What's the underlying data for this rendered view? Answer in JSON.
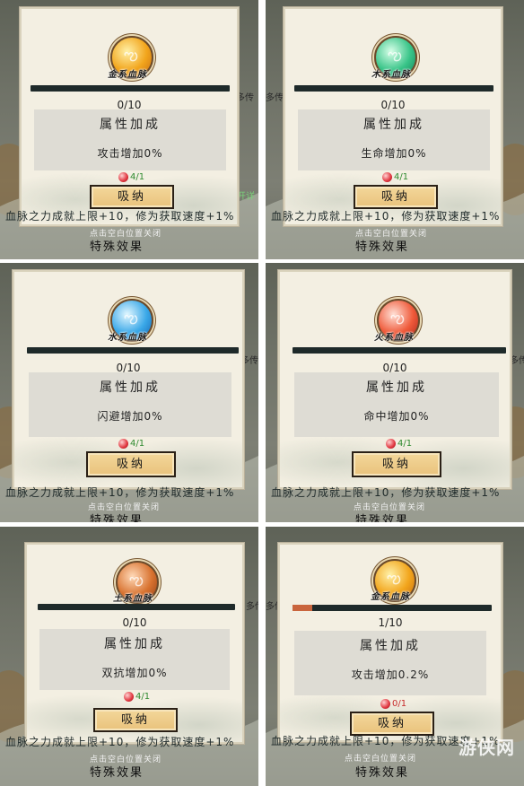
{
  "common": {
    "section_title": "属性加成",
    "absorb_label": "吸纳",
    "close_hint": "点击空白位置关闭",
    "special_effects": "特殊效果",
    "bottom_line": "血脉之力成就上限+10，修为获取速度+1%",
    "side_text_more": "多传",
    "side_text_detail": "开详"
  },
  "cells": [
    {
      "orb_label": "金系血脉",
      "progress": "0/10",
      "progress_ratio": 0.0,
      "effect": "攻击增加0%",
      "cost": "4/1",
      "cost_color": "#2f8a2f",
      "orb_gradient": "radial-gradient(circle at 38% 35%, #fff1a8, #f2a51c 55%, #c56a12)"
    },
    {
      "orb_label": "木系血脉",
      "progress": "0/10",
      "progress_ratio": 0.0,
      "effect": "生命增加0%",
      "cost": "4/1",
      "cost_color": "#2f8a2f",
      "orb_gradient": "radial-gradient(circle at 38% 35%, #d9ffe9, #38c488 55%, #14805a)"
    },
    {
      "orb_label": "水系血脉",
      "progress": "0/10",
      "progress_ratio": 0.0,
      "effect": "闪避增加0%",
      "cost": "4/1",
      "cost_color": "#2f8a2f",
      "orb_gradient": "radial-gradient(circle at 38% 35%, #e2f7ff, #3aa8e8 55%, #1461b0)"
    },
    {
      "orb_label": "火系血脉",
      "progress": "0/10",
      "progress_ratio": 0.0,
      "effect": "命中增加0%",
      "cost": "4/1",
      "cost_color": "#2f8a2f",
      "orb_gradient": "radial-gradient(circle at 38% 35%, #ffe0d6, #ef5a3a 55%, #a7231b)"
    },
    {
      "orb_label": "土系血脉",
      "progress": "0/10",
      "progress_ratio": 0.0,
      "effect": "双抗增加0%",
      "cost": "4/1",
      "cost_color": "#2f8a2f",
      "orb_gradient": "radial-gradient(circle at 38% 35%, #ffd9b8, #d8722f 55%, #8e3d16)"
    },
    {
      "orb_label": "金系血脉",
      "progress": "1/10",
      "progress_ratio": 0.1,
      "effect": "攻击增加0.2%",
      "cost": "0/1",
      "cost_color": "#c62a2a",
      "orb_gradient": "radial-gradient(circle at 38% 35%, #fff1a8, #f2a51c 55%, #c56a12)"
    }
  ],
  "watermark": "游侠网"
}
